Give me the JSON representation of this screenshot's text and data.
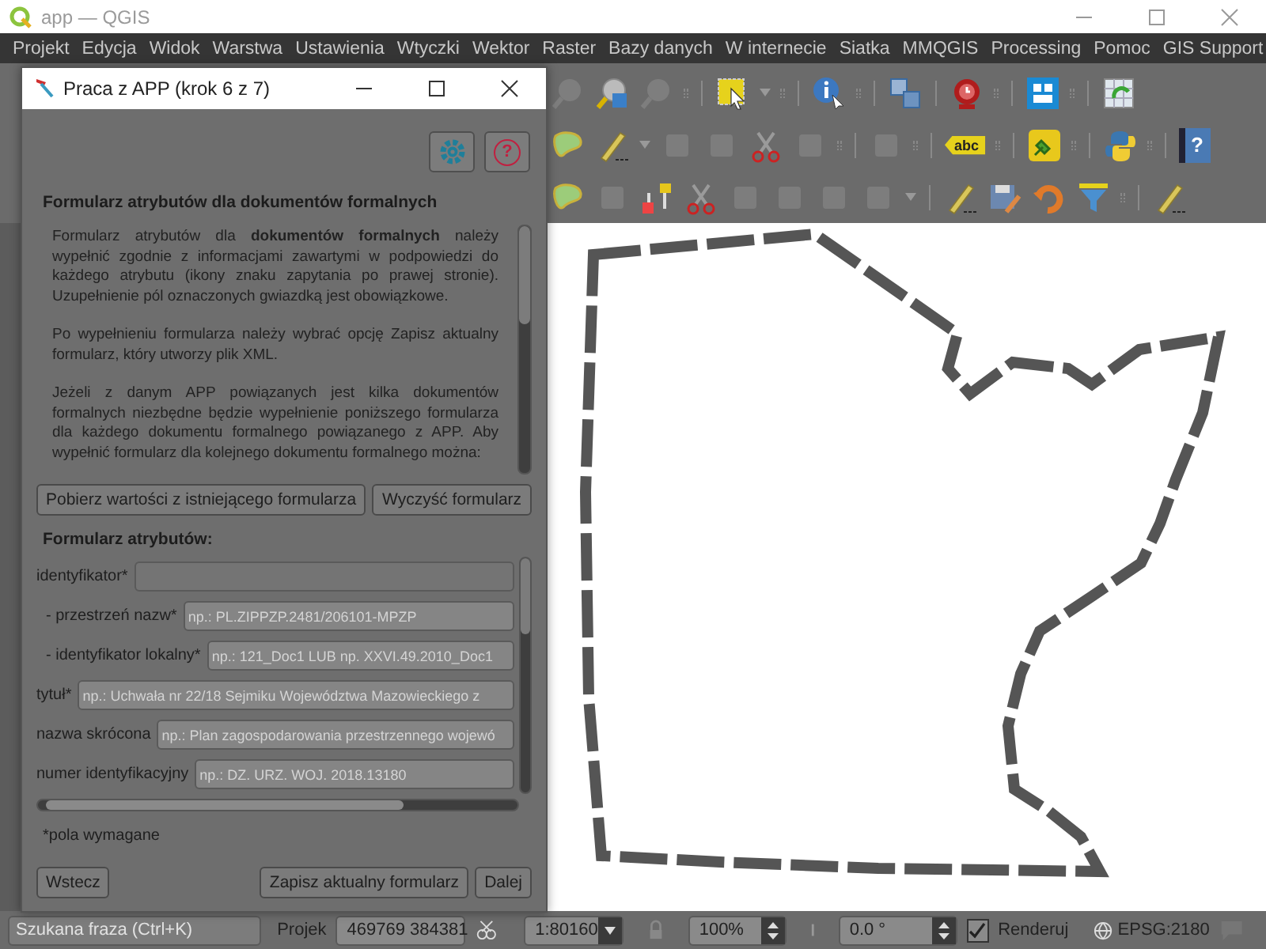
{
  "window": {
    "title": "app — QGIS"
  },
  "menu": [
    "Projekt",
    "Edycja",
    "Widok",
    "Warstwa",
    "Ustawienia",
    "Wtyczki",
    "Wektor",
    "Raster",
    "Bazy danych",
    "W internecie",
    "Siatka",
    "MMQGIS",
    "Processing",
    "Pomoc",
    "GIS Support"
  ],
  "toolbar": {
    "label_tool": "abc",
    "help_tool": "?"
  },
  "dialog": {
    "title": "Praca z APP (krok 6 z 7)",
    "help_button": "?",
    "heading": "Formularz atrybutów dla dokumentów formalnych",
    "paragraphs": [
      "Formularz atrybutów dla **dokumentów formalnych** należy wypełnić zgodnie z informacjami zawartymi w podpowiedzi do każdego atrybutu (ikony znaku zapytania po prawej stronie). Uzupełnienie pól oznaczonych gwiazdką jest obowiązkowe.",
      "Po wypełnieniu formularza należy wybrać opcję Zapisz aktualny formularz, który utworzy plik XML.",
      "Jeżeli z danym APP powiązanych jest kilka dokumentów formalnych niezbędne będzie wypełnienie poniższego formularza dla każdego dokumentu formalnego powiązanego z APP. Aby wypełnić formularz dla kolejnego dokumentu formalnego można:"
    ],
    "top_buttons": [
      "Pobierz wartości z istniejącego formularza",
      "Wyczyść formularz"
    ],
    "form_title": "Formularz atrybutów:",
    "fields": [
      {
        "label": "identyfikator*",
        "children": [
          {
            "label": "- przestrzeń nazw*",
            "placeholder": "np.: PL.ZIPPZP.2481/206101-MPZP"
          },
          {
            "label": "- identyfikator lokalny*",
            "placeholder": "np.: 121_Doc1 LUB np. XXVI.49.2010_Doc1"
          }
        ]
      },
      {
        "label": "tytuł*",
        "placeholder": "np.: Uchwała nr 22/18 Sejmiku Województwa Mazowieckiego z"
      },
      {
        "label": "nazwa skrócona",
        "placeholder": "np.: Plan zagospodarowania przestrzennego wojewó"
      },
      {
        "label": "numer identyfikacyjny",
        "placeholder": "np.: DZ. URZ. WOJ. 2018.13180"
      }
    ],
    "required_note": "*pola wymagane",
    "buttons": [
      "Wstecz",
      "Zapisz aktualny formularz",
      "Dalej"
    ]
  },
  "status_bar": {
    "search": {
      "placeholder": "Szukana fraza (Ctrl+K)"
    },
    "coordinate_label": "Projek",
    "coordinate": "469769  384381",
    "scale": "1:80160",
    "magnifier": "100%",
    "rotation": "0.0 °",
    "render": {
      "label": "Renderuj",
      "checked": true
    },
    "crs": "EPSG:2180"
  }
}
